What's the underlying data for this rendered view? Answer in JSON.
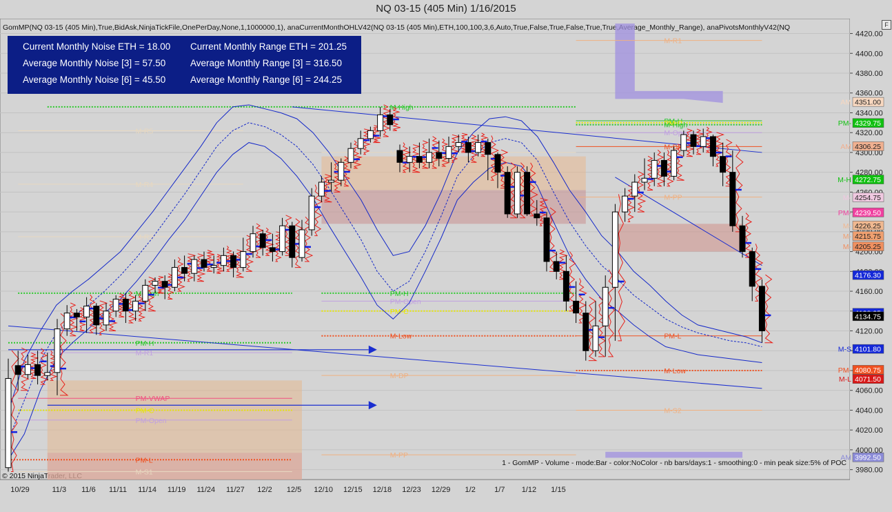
{
  "window": {
    "title": "NQ 03-15 (405 Min)  1/16/2015",
    "corner_button": "F",
    "copyright": "© 2015 NinjaTrader, LLC"
  },
  "indicator_line": "GomMP(NQ 03-15 (405 Min),True,BidAsk,NinjaTickFile,OnePerDay,None,1,1000000,1), anaCurrentMonthOHLV42(NQ 03-15 (405 Min),ETH,100,100,3,6,Auto,True,False,True,False,True,True,Average_Monthly_Range), anaPivotsMonthlyV42(NQ",
  "stats_box": {
    "rows": [
      {
        "left": "Current Monthly Noise ETH = 18.00",
        "right": "Current Monthly Range ETH = 201.25"
      },
      {
        "left": "Average Monthly Noise [3] = 57.50",
        "right": "Average Monthly Range [3] = 316.50"
      },
      {
        "left": "Average Monthly Noise [6] = 45.50",
        "right": "Average Monthly Range [6] = 244.25"
      }
    ]
  },
  "footer_note": "1 - GomMP - Volume - mode:Bar - color:NoColor - nb bars/days:1 - smoothing:0 - min peak size:5% of POC",
  "colors": {
    "background": "#d4d4d4",
    "stats_box": "#0c1e86",
    "channel": "#1428c8",
    "trend": "#1a2ed0",
    "up_candle": "#ffffff",
    "down_candle": "#000000",
    "profile": "#e8201a",
    "poc_tick": "#1020e0",
    "green_level": "#28c828",
    "yellow_level": "#e8e800",
    "salmon_level": "#f09050",
    "red_level": "#d81818",
    "violet_zone": "#a090e0"
  },
  "chart_data": {
    "type": "candlestick",
    "symbol": "NQ 03-15",
    "timeframe": "405 Min",
    "y_axis": {
      "min": 3970,
      "max": 4435,
      "ticks": [
        3980,
        4000,
        4020,
        4040,
        4060,
        4080,
        4100,
        4120,
        4140,
        4160,
        4180,
        4200,
        4220,
        4240,
        4260,
        4280,
        4300,
        4320,
        4340,
        4360,
        4380,
        4400,
        4420
      ],
      "tick_labels": [
        "3980.00",
        "4000.00",
        "4020.00",
        "4040.00",
        "4060.00",
        "4080.00",
        "4100.00",
        "4120.00",
        "4140.00",
        "4160.00",
        "4180.00",
        "4200.00",
        "4220.00",
        "4240.00",
        "4260.00",
        "4280.00",
        "4300.00",
        "4320.00",
        "4340.00",
        "4360.00",
        "4380.00",
        "4400.00",
        "4420.00"
      ]
    },
    "x_axis": {
      "bar_count": 78,
      "dates": [
        {
          "label": "10/29",
          "bar": 1
        },
        {
          "label": "11/3",
          "bar": 5
        },
        {
          "label": "11/6",
          "bar": 8
        },
        {
          "label": "11/11",
          "bar": 11
        },
        {
          "label": "11/14",
          "bar": 14
        },
        {
          "label": "11/19",
          "bar": 17
        },
        {
          "label": "11/24",
          "bar": 20
        },
        {
          "label": "11/27",
          "bar": 23
        },
        {
          "label": "12/2",
          "bar": 26
        },
        {
          "label": "12/5",
          "bar": 29
        },
        {
          "label": "12/10",
          "bar": 32
        },
        {
          "label": "12/15",
          "bar": 35
        },
        {
          "label": "12/18",
          "bar": 38
        },
        {
          "label": "12/23",
          "bar": 41
        },
        {
          "label": "12/29",
          "bar": 44
        },
        {
          "label": "1/2",
          "bar": 47
        },
        {
          "label": "1/7",
          "bar": 50
        },
        {
          "label": "1/12",
          "bar": 53
        },
        {
          "label": "1/15",
          "bar": 56
        }
      ]
    },
    "candles": [
      [
        3982,
        4072,
        3978,
        4092
      ],
      [
        4085,
        4076,
        4060,
        4100
      ],
      [
        4076,
        4086,
        4072,
        4096
      ],
      [
        4086,
        4075,
        4066,
        4100
      ],
      [
        4075,
        4078,
        4070,
        4098
      ],
      [
        4078,
        4122,
        4055,
        4132
      ],
      [
        4122,
        4138,
        4115,
        4146
      ],
      [
        4138,
        4134,
        4120,
        4142
      ],
      [
        4134,
        4145,
        4118,
        4154
      ],
      [
        4145,
        4126,
        4116,
        4148
      ],
      [
        4126,
        4140,
        4120,
        4148
      ],
      [
        4140,
        4152,
        4134,
        4156
      ],
      [
        4152,
        4140,
        4128,
        4158
      ],
      [
        4140,
        4150,
        4130,
        4156
      ],
      [
        4150,
        4166,
        4140,
        4172
      ],
      [
        4166,
        4170,
        4158,
        4174
      ],
      [
        4170,
        4164,
        4152,
        4176
      ],
      [
        4164,
        4184,
        4160,
        4192
      ],
      [
        4184,
        4178,
        4170,
        4196
      ],
      [
        4178,
        4192,
        4170,
        4196
      ],
      [
        4192,
        4184,
        4180,
        4200
      ],
      [
        4184,
        4186,
        4178,
        4196
      ],
      [
        4186,
        4196,
        4180,
        4204
      ],
      [
        4196,
        4184,
        4174,
        4200
      ],
      [
        4184,
        4200,
        4180,
        4214
      ],
      [
        4200,
        4218,
        4194,
        4226
      ],
      [
        4218,
        4204,
        4196,
        4222
      ],
      [
        4204,
        4200,
        4190,
        4218
      ],
      [
        4200,
        4226,
        4196,
        4234
      ],
      [
        4226,
        4194,
        4184,
        4230
      ],
      [
        4194,
        4222,
        4190,
        4232
      ],
      [
        4222,
        4256,
        4216,
        4264
      ],
      [
        4256,
        4270,
        4250,
        4276
      ],
      [
        4270,
        4272,
        4260,
        4290
      ],
      [
        4272,
        4290,
        4266,
        4294
      ],
      [
        4290,
        4304,
        4284,
        4310
      ],
      [
        4304,
        4314,
        4298,
        4322
      ],
      [
        4314,
        4322,
        4310,
        4326
      ],
      [
        4322,
        4338,
        4316,
        4346
      ],
      [
        4338,
        4328,
        4322,
        4344
      ],
      [
        4302,
        4290,
        4280,
        4308
      ],
      [
        4290,
        4296,
        4280,
        4306
      ],
      [
        4296,
        4290,
        4284,
        4310
      ],
      [
        4290,
        4300,
        4284,
        4314
      ],
      [
        4300,
        4294,
        4286,
        4312
      ],
      [
        4294,
        4306,
        4290,
        4316
      ],
      [
        4306,
        4310,
        4300,
        4318
      ],
      [
        4310,
        4300,
        4290,
        4316
      ],
      [
        4300,
        4310,
        4296,
        4318
      ],
      [
        4310,
        4298,
        4272,
        4314
      ],
      [
        4298,
        4280,
        4264,
        4300
      ],
      [
        4280,
        4238,
        4234,
        4286
      ],
      [
        4238,
        4280,
        4234,
        4286
      ],
      [
        4280,
        4238,
        4236,
        4286
      ],
      [
        4238,
        4234,
        4226,
        4252
      ],
      [
        4234,
        4190,
        4180,
        4240
      ],
      [
        4190,
        4180,
        4172,
        4200
      ],
      [
        4180,
        4150,
        4140,
        4196
      ],
      [
        4150,
        4138,
        4128,
        4170
      ],
      [
        4138,
        4100,
        4090,
        4150
      ],
      [
        4100,
        4125,
        4094,
        4150
      ],
      [
        4125,
        4164,
        4094,
        4176
      ],
      [
        4164,
        4240,
        4110,
        4248
      ],
      [
        4240,
        4256,
        4230,
        4264
      ],
      [
        4256,
        4270,
        4240,
        4278
      ],
      [
        4270,
        4274,
        4262,
        4294
      ],
      [
        4274,
        4292,
        4266,
        4300
      ],
      [
        4292,
        4276,
        4266,
        4300
      ],
      [
        4276,
        4302,
        4272,
        4306
      ],
      [
        4302,
        4318,
        4296,
        4322
      ],
      [
        4318,
        4306,
        4298,
        4322
      ],
      [
        4306,
        4316,
        4300,
        4324
      ],
      [
        4316,
        4296,
        4286,
        4318
      ],
      [
        4296,
        4280,
        4266,
        4310
      ],
      [
        4280,
        4226,
        4220,
        4302
      ],
      [
        4226,
        4200,
        4194,
        4236
      ],
      [
        4200,
        4165,
        4150,
        4204
      ],
      [
        4165,
        4120,
        4108,
        4172
      ]
    ],
    "channel": {
      "upper": [
        4038,
        4090,
        4120,
        4146,
        4160,
        4172,
        4186,
        4200,
        4220,
        4240,
        4262,
        4284,
        4306,
        4330,
        4346,
        4348,
        4344,
        4340,
        4334,
        4320,
        4300,
        4276,
        4252,
        4222,
        4196,
        4200,
        4226,
        4260,
        4300,
        4320,
        4334,
        4336,
        4332,
        4316,
        4290,
        4262,
        4240,
        4216,
        4200,
        4180,
        4166,
        4150,
        4136,
        4126,
        4122,
        4118,
        4114,
        4108
      ],
      "middle": [
        4010,
        4050,
        4090,
        4118,
        4134,
        4146,
        4160,
        4176,
        4194,
        4214,
        4236,
        4258,
        4282,
        4306,
        4322,
        4330,
        4326,
        4318,
        4306,
        4288,
        4264,
        4238,
        4212,
        4180,
        4160,
        4170,
        4200,
        4236,
        4276,
        4296,
        4310,
        4314,
        4310,
        4292,
        4260,
        4230,
        4206,
        4186,
        4172,
        4156,
        4144,
        4132,
        4124,
        4118,
        4114,
        4110,
        4108,
        4104
      ],
      "lower": [
        3990,
        4016,
        4060,
        4092,
        4108,
        4122,
        4138,
        4152,
        4170,
        4190,
        4212,
        4232,
        4256,
        4280,
        4298,
        4310,
        4306,
        4294,
        4276,
        4254,
        4226,
        4200,
        4174,
        4146,
        4132,
        4148,
        4180,
        4214,
        4252,
        4270,
        4284,
        4290,
        4286,
        4266,
        4230,
        4196,
        4172,
        4152,
        4140,
        4126,
        4114,
        4104,
        4100,
        4096,
        4094,
        4092,
        4090,
        4088
      ]
    },
    "trend_lines": [
      {
        "from": [
          1,
          4125
        ],
        "to": [
          78,
          4062
        ]
      },
      {
        "from": [
          30,
          4346
        ],
        "to": [
          78,
          4300
        ]
      },
      {
        "from": [
          63,
          4275
        ],
        "to": [
          78,
          4186
        ]
      }
    ],
    "arrows": [
      {
        "bar_from": 1,
        "bar_to": 35,
        "value": 4101
      },
      {
        "bar_from": 5,
        "bar_to": 35,
        "value": 4045
      }
    ],
    "levels": [
      {
        "label": "M-High",
        "value": 4346,
        "start": 5,
        "end": 59,
        "color": "#28c828",
        "dotted": true,
        "label_bar": 40
      },
      {
        "label": "M-R5",
        "value": 4322,
        "start": 2,
        "end": 25,
        "color": "#e8d8c0",
        "dotted": false,
        "label_bar": 14
      },
      {
        "label": "M-R4",
        "value": 4268,
        "start": 2,
        "end": 25,
        "color": "#e8d8c0",
        "dotted": false,
        "label_bar": 14
      },
      {
        "label": "M-R3",
        "value": 4215,
        "start": 2,
        "end": 25,
        "color": "#e8d8c0",
        "dotted": false,
        "label_bar": 14
      },
      {
        "label": "M-High",
        "value": 4158,
        "start": 2,
        "end": 30,
        "color": "#28c828",
        "dotted": true,
        "label_bar": 14
      },
      {
        "label": "PM-H",
        "value": 4108,
        "start": 1,
        "end": 30,
        "color": "#28c828",
        "dotted": true,
        "label_bar": 14
      },
      {
        "label": "M-R1",
        "value": 4098,
        "start": 2,
        "end": 30,
        "color": "#c0a0e0",
        "dotted": false,
        "label_bar": 14
      },
      {
        "label": "PM-VWAP",
        "value": 4052,
        "start": 2,
        "end": 30,
        "color": "#f05080",
        "dotted": false,
        "label_bar": 14
      },
      {
        "label": "PM-C",
        "value": 4040,
        "start": 2,
        "end": 30,
        "color": "#e8e800",
        "dotted": true,
        "label_bar": 14
      },
      {
        "label": "PM-Open",
        "value": 4030,
        "start": 2,
        "end": 30,
        "color": "#c0a0e0",
        "dotted": false,
        "label_bar": 14
      },
      {
        "label": "PM-L",
        "value": 3990,
        "start": 1,
        "end": 30,
        "color": "#f05020",
        "dotted": true,
        "label_bar": 14
      },
      {
        "label": "M-S1",
        "value": 3978,
        "start": 2,
        "end": 30,
        "color": "#e8d8c0",
        "dotted": false,
        "label_bar": 14
      },
      {
        "label": "M-R1",
        "value": 4300,
        "start": 33,
        "end": 59,
        "color": "#e8d8c0",
        "dotted": false,
        "label_bar": 40
      },
      {
        "label": "PM-H",
        "value": 4158,
        "start": 33,
        "end": 59,
        "color": "#28c828",
        "dotted": true,
        "label_bar": 40
      },
      {
        "label": "PM-Open",
        "value": 4150,
        "start": 33,
        "end": 59,
        "color": "#c0a0e0",
        "dotted": false,
        "label_bar": 40
      },
      {
        "label": "PM-C",
        "value": 4140,
        "start": 33,
        "end": 59,
        "color": "#e8e800",
        "dotted": true,
        "label_bar": 40
      },
      {
        "label": "M-Low",
        "value": 4115,
        "start": 33,
        "end": 59,
        "color": "#f05020",
        "dotted": true,
        "label_bar": 40
      },
      {
        "label": "M-DP",
        "value": 4075,
        "start": 33,
        "end": 59,
        "color": "#f0b080",
        "dotted": false,
        "label_bar": 40
      },
      {
        "label": "M-PP",
        "value": 3995,
        "start": 33,
        "end": 59,
        "color": "#f0b080",
        "dotted": false,
        "label_bar": 40
      },
      {
        "label": "M-R1",
        "value": 4413,
        "start": 59,
        "end": 78,
        "color": "#f0b080",
        "dotted": false,
        "label_bar": 68
      },
      {
        "label": "PM-H",
        "value": 4332,
        "start": 59,
        "end": 78,
        "color": "#28c828",
        "dotted": false,
        "label_bar": 68
      },
      {
        "label": "PM-C",
        "value": 4330,
        "start": 59,
        "end": 78,
        "color": "#e8e800",
        "dotted": true,
        "label_bar": 68
      },
      {
        "label": "M-High",
        "value": 4328,
        "start": 59,
        "end": 78,
        "color": "#28c828",
        "dotted": true,
        "label_bar": 68
      },
      {
        "label": "M-Open",
        "value": 4320,
        "start": 59,
        "end": 78,
        "color": "#c0a0e0",
        "dotted": false,
        "label_bar": 68
      },
      {
        "label": "M-DP",
        "value": 4306,
        "start": 59,
        "end": 78,
        "color": "#f05020",
        "dotted": false,
        "label_bar": 68
      },
      {
        "label": "M-PP",
        "value": 4255,
        "start": 59,
        "end": 78,
        "color": "#f0b080",
        "dotted": false,
        "label_bar": 68
      },
      {
        "label": "PM-L",
        "value": 4115,
        "start": 59,
        "end": 78,
        "color": "#f05020",
        "dotted": false,
        "label_bar": 68
      },
      {
        "label": "M-Low",
        "value": 4080,
        "start": 59,
        "end": 78,
        "color": "#f05020",
        "dotted": true,
        "label_bar": 68
      },
      {
        "label": "M-S2",
        "value": 4040,
        "start": 59,
        "end": 78,
        "color": "#f0b080",
        "dotted": false,
        "label_bar": 68
      }
    ],
    "price_tags": [
      {
        "value": 4351.0,
        "label": "4351.00",
        "bg": "#f8d8c0",
        "fg": "#222",
        "prefix": "AM"
      },
      {
        "value": 4329.75,
        "label": "4329.75",
        "bg": "#10c010",
        "fg": "#fff",
        "prefix": "PM-"
      },
      {
        "value": 4306.25,
        "label": "4306.25",
        "bg": "#f0b090",
        "fg": "#222",
        "prefix": "AM"
      },
      {
        "value": 4272.75,
        "label": "4272.75",
        "bg": "#10c010",
        "fg": "#fff",
        "prefix": "M-H"
      },
      {
        "value": 4254.75,
        "label": "4254.75",
        "bg": "#f0c8e0",
        "fg": "#222",
        "prefix": "M-"
      },
      {
        "value": 4239.5,
        "label": "4239.50",
        "bg": "#f040a0",
        "fg": "#fff",
        "prefix": "PM-"
      },
      {
        "value": 4226.25,
        "label": "4226.25",
        "bg": "#f0b890",
        "fg": "#222",
        "prefix": "M-"
      },
      {
        "value": 4215.75,
        "label": "4215.75",
        "bg": "#f0a070",
        "fg": "#222",
        "prefix": "M-"
      },
      {
        "value": 4205.25,
        "label": "4205.25",
        "bg": "#f09060",
        "fg": "#222",
        "prefix": "M-"
      },
      {
        "value": 4176.3,
        "label": "4176.30",
        "bg": "#1428d8",
        "fg": "#fff",
        "prefix": ""
      },
      {
        "value": 4138.25,
        "label": "4138.25",
        "bg": "#1428d8",
        "fg": "#fff",
        "prefix": ""
      },
      {
        "value": 4134.75,
        "label": "4134.75",
        "bg": "#000000",
        "fg": "#fff",
        "prefix": ""
      },
      {
        "value": 4101.8,
        "label": "4101.80",
        "bg": "#1428d8",
        "fg": "#fff",
        "prefix": "M-S"
      },
      {
        "value": 4080.75,
        "label": "4080.75",
        "bg": "#f05020",
        "fg": "#fff",
        "prefix": "PM-"
      },
      {
        "value": 4071.5,
        "label": "4071.50",
        "bg": "#d81818",
        "fg": "#fff",
        "prefix": "M-L"
      },
      {
        "value": 3992.5,
        "label": "3992.50",
        "bg": "#8c8cd8",
        "fg": "#fff",
        "prefix": "AM"
      }
    ]
  }
}
